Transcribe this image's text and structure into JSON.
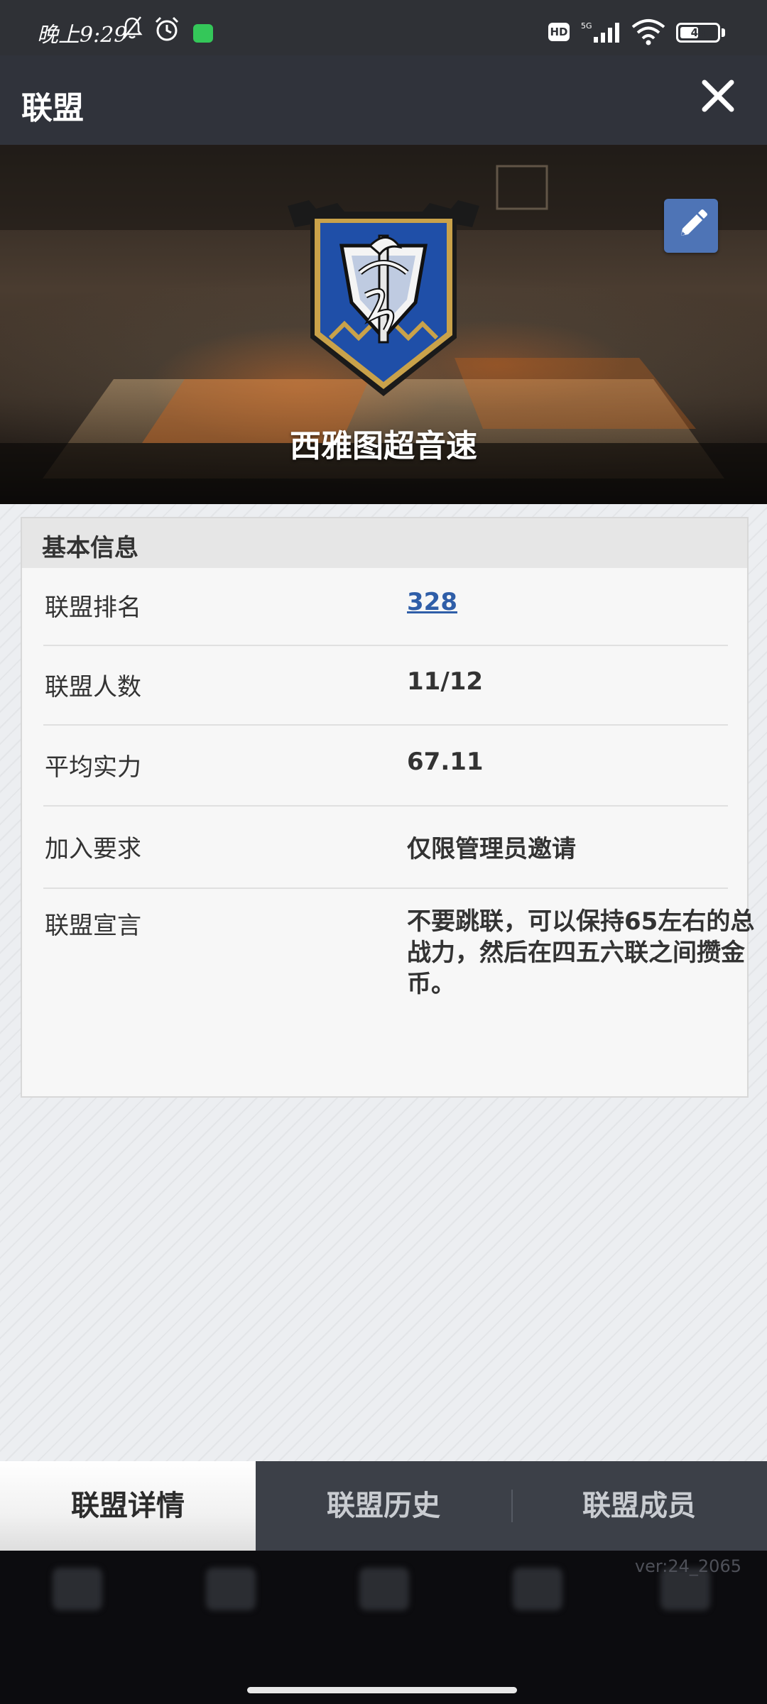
{
  "status_bar": {
    "time": "晚上9:29",
    "hd_badge": "HD",
    "network": "5G",
    "battery_level": "49",
    "battery_fraction": 0.49
  },
  "header": {
    "title": "联盟"
  },
  "banner": {
    "alliance_name": "西雅图超音速"
  },
  "info_card": {
    "title": "基本信息",
    "rows": [
      {
        "label": "联盟排名",
        "value": "328"
      },
      {
        "label": "联盟人数",
        "value": "11/12"
      },
      {
        "label": "平均实力",
        "value": "67.11"
      },
      {
        "label": "加入要求",
        "value": "仅限管理员邀请"
      },
      {
        "label": "联盟宣言",
        "value": "不要跳联，可以保持65左右的总战力，然后在四五六联之间攒金币。"
      }
    ]
  },
  "tabs": [
    {
      "label": "联盟详情",
      "active": true
    },
    {
      "label": "联盟历史",
      "active": false
    },
    {
      "label": "联盟成员",
      "active": false
    }
  ],
  "footer": {
    "version": "ver:24_2065"
  },
  "colors": {
    "header_bg": "#30333b",
    "link": "#2f5ea8",
    "edit_button": "#4e74b6",
    "crest_blue": "#1f4fa8",
    "crest_gold": "#c9a24a"
  },
  "icons": {
    "close": "close-icon",
    "edit": "pencil-icon",
    "crest": "alliance-crest-icon"
  }
}
